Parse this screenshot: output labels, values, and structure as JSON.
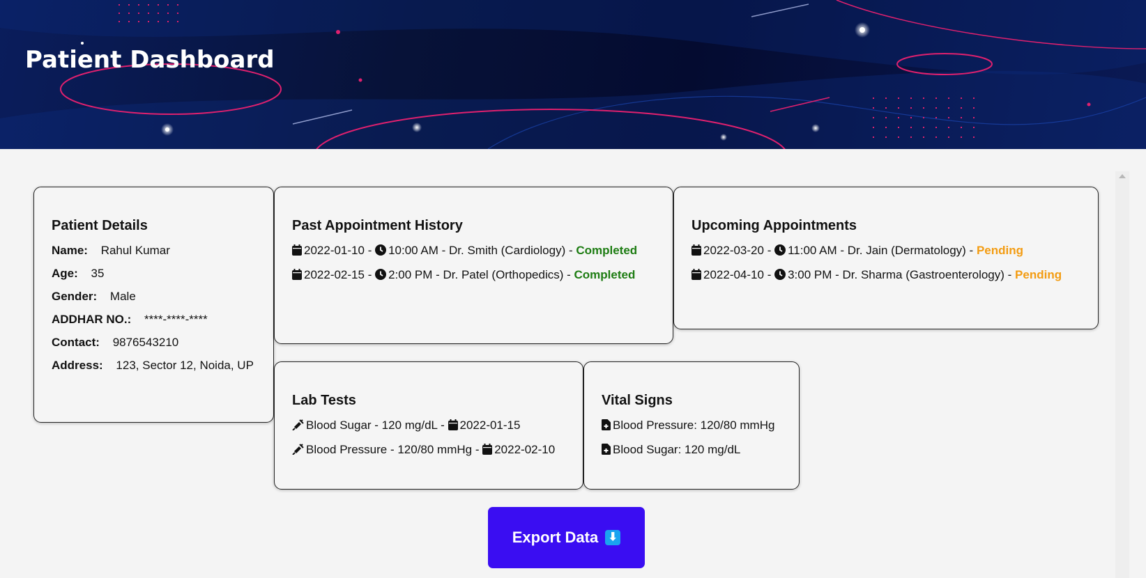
{
  "header": {
    "title": "Patient Dashboard"
  },
  "patient": {
    "heading": "Patient Details",
    "fields": [
      {
        "label": "Name:",
        "value": "Rahul Kumar"
      },
      {
        "label": "Age:",
        "value": "35"
      },
      {
        "label": "Gender:",
        "value": "Male"
      },
      {
        "label": "ADDHAR NO.:",
        "value": "****-****-****"
      },
      {
        "label": "Contact:",
        "value": "9876543210"
      },
      {
        "label": "Address:",
        "value": "123, Sector 12, Noida, UP"
      }
    ]
  },
  "past": {
    "heading": "Past Appointment History",
    "items": [
      {
        "date": "2022-01-10",
        "time": "10:00 AM",
        "doctor": "Dr. Smith (Cardiology)",
        "status": "Completed"
      },
      {
        "date": "2022-02-15",
        "time": "2:00 PM",
        "doctor": "Dr. Patel (Orthopedics)",
        "status": "Completed"
      }
    ]
  },
  "upcoming": {
    "heading": "Upcoming Appointments",
    "items": [
      {
        "date": "2022-03-20",
        "time": "11:00 AM",
        "doctor": "Dr. Jain (Dermatology)",
        "status": "Pending"
      },
      {
        "date": "2022-04-10",
        "time": "3:00 PM",
        "doctor": "Dr. Sharma (Gastroenterology)",
        "status": "Pending"
      }
    ]
  },
  "lab": {
    "heading": "Lab Tests",
    "items": [
      {
        "test": "Blood Sugar - 120 mg/dL",
        "date": "2022-01-15"
      },
      {
        "test": "Blood Pressure - 120/80 mmHg",
        "date": "2022-02-10"
      }
    ]
  },
  "vitals": {
    "heading": "Vital Signs",
    "items": [
      {
        "text": "Blood Pressure: 120/80 mmHg"
      },
      {
        "text": "Blood Sugar: 120 mg/dL"
      }
    ]
  },
  "export": {
    "label": "Export Data",
    "icon": "download-icon"
  },
  "colors": {
    "completed": "#1d7c12",
    "pending": "#f39c12",
    "button": "#3a0df2",
    "banner": "#071238"
  },
  "icons": {
    "date": "calendar-icon",
    "time": "clock-icon",
    "lab": "syringe-icon",
    "vital": "file-medical-icon"
  }
}
